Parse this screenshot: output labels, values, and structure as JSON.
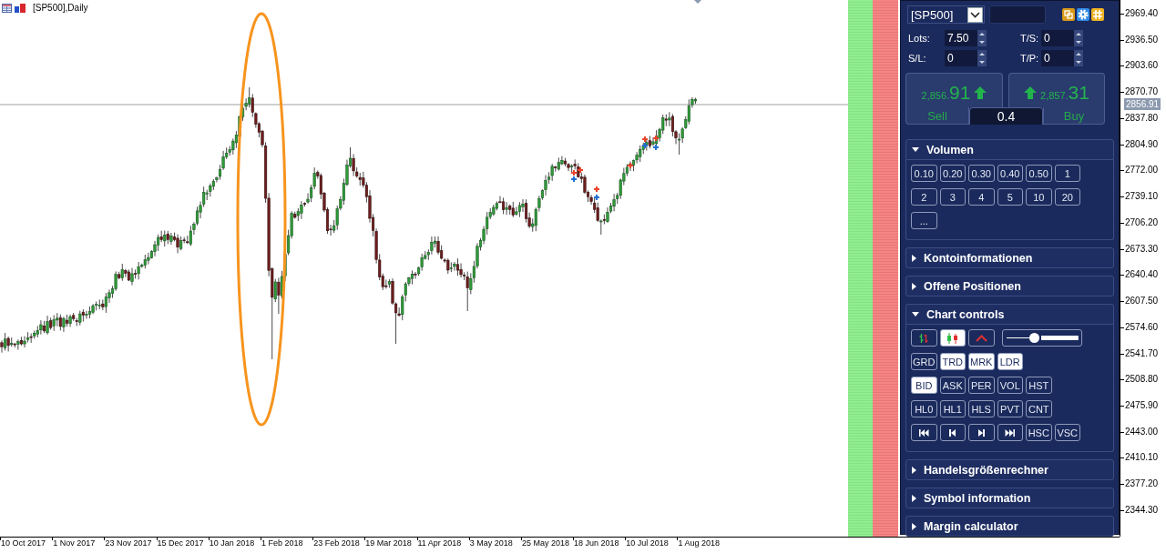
{
  "chart": {
    "title": "[SP500],Daily",
    "price_axis": [
      "2969.40",
      "2936.50",
      "2903.60",
      "2870.70",
      "2837.80",
      "2804.90",
      "2772.00",
      "2739.10",
      "2706.20",
      "2673.30",
      "2640.40",
      "2607.50",
      "2574.60",
      "2541.70",
      "2508.80",
      "2475.90",
      "2443.00",
      "2410.10",
      "2377.20",
      "2344.30"
    ],
    "current_price": "2856.91",
    "time_axis": [
      "10 Oct 2017",
      "1 Nov 2017",
      "23 Nov 2017",
      "15 Dec 2017",
      "10 Jan 2018",
      "1 Feb 2018",
      "23 Feb 2018",
      "19 Mar 2018",
      "11 Apr 2018",
      "3 May 2018",
      "25 May 2018",
      "18 Jun 2018",
      "10 Jul 2018",
      "1 Aug 2018"
    ]
  },
  "panel": {
    "symbol": "[SP500]",
    "order_fields": [
      {
        "label": "Lots:",
        "value": "7.50"
      },
      {
        "label": "T/S:",
        "value": "0"
      },
      {
        "label": "S/L:",
        "value": "0"
      },
      {
        "label": "T/P:",
        "value": "0"
      }
    ],
    "quotes": [
      {
        "kind": "sell",
        "price": "2,856.",
        "pips": "91",
        "label": "Sell"
      },
      {
        "kind": "buy",
        "price": "2,857.",
        "pips": "31",
        "label": "Buy"
      }
    ],
    "spread": "0.4",
    "sections": [
      {
        "kind": "volume",
        "title": "Volumen",
        "expanded": true,
        "button_rows": [
          [
            "0.10",
            "0.20",
            "0.30",
            "0.40",
            "0.50",
            "1"
          ],
          [
            "2",
            "3",
            "4",
            "5",
            "10",
            "20"
          ],
          [
            "..."
          ]
        ]
      },
      {
        "title": "Kontoinformationen",
        "expanded": false
      },
      {
        "title": "Offene Positionen",
        "expanded": false
      },
      {
        "kind": "chart_controls",
        "title": "Chart controls",
        "expanded": true,
        "chart_types": [
          {
            "kind": "bars",
            "selected": false
          },
          {
            "kind": "candles",
            "selected": true
          },
          {
            "kind": "line",
            "selected": false
          }
        ],
        "zoom": {
          "level": 0.4
        },
        "toggle_rows": [
          [
            {
              "label": "GRD",
              "selected": false
            },
            {
              "label": "TRD",
              "selected": true
            },
            {
              "label": "MRK",
              "selected": true
            },
            {
              "label": "LDR",
              "selected": true
            }
          ],
          [
            {
              "label": "BID",
              "selected": true
            },
            {
              "label": "ASK",
              "selected": false
            },
            {
              "label": "PER",
              "selected": false
            },
            {
              "label": "VOL",
              "selected": false
            },
            {
              "label": "HST",
              "selected": false
            }
          ],
          [
            {
              "label": "HL0",
              "selected": false
            },
            {
              "label": "HL1",
              "selected": false
            },
            {
              "label": "HLS",
              "selected": false
            },
            {
              "label": "PVT",
              "selected": false
            },
            {
              "label": "CNT",
              "selected": false
            }
          ]
        ],
        "navigation": [
          {
            "kind": "first"
          },
          {
            "kind": "previous"
          },
          {
            "kind": "next"
          },
          {
            "kind": "last"
          },
          {
            "kind": "toggle",
            "label": "HSC",
            "selected": false
          },
          {
            "kind": "toggle",
            "label": "VSC",
            "selected": false
          }
        ]
      },
      {
        "title": "Handelsgrößenrechner",
        "expanded": false
      },
      {
        "title": "Symbol information",
        "expanded": false
      },
      {
        "title": "Margin calculator",
        "expanded": false
      }
    ]
  }
}
